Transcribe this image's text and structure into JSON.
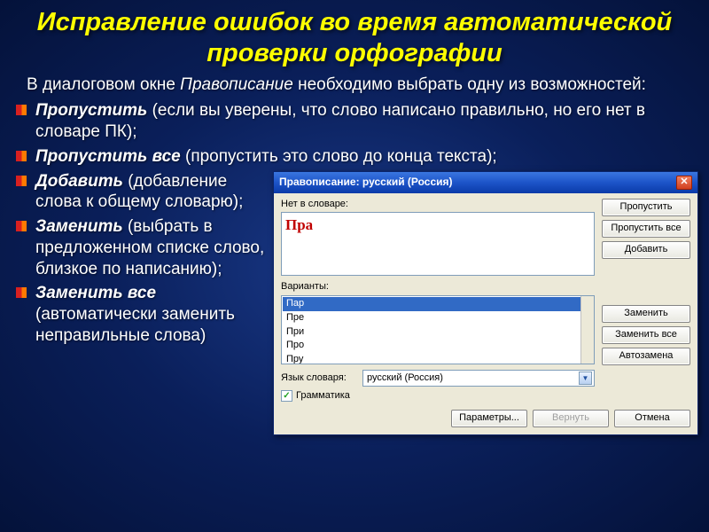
{
  "slide": {
    "title": "Исправление ошибок во время автоматической проверки орфографии",
    "intro_a": "В диалоговом окне ",
    "intro_em": "Правописание",
    "intro_b": " необходимо выбрать одну из возможностей:",
    "items": [
      {
        "term": "Пропустить",
        "rest": " (если вы уверены, что слово написано правильно, но его нет в словаре ПК);"
      },
      {
        "term": "Пропустить все ",
        "rest": " (пропустить это слово до конца текста);"
      },
      {
        "term": "Добавить ",
        "rest": " (добавление слова к общему словарю);"
      },
      {
        "term": "Заменить ",
        "rest": " (выбрать в предложенном списке слово, близкое по написанию);"
      },
      {
        "term": "Заменить все",
        "rest": " (автоматически заменить неправильные слова)"
      }
    ]
  },
  "dialog": {
    "title": "Правописание: русский (Россия)",
    "not_in_dict_label": "Нет в словаре:",
    "word": "Пра",
    "variants_label": "Варианты:",
    "variants": [
      "Пар",
      "Пре",
      "При",
      "Про",
      "Пру"
    ],
    "lang_label": "Язык словаря:",
    "lang_value": "русский (Россия)",
    "grammar_label": "Грамматика",
    "grammar_checked": "✓",
    "buttons": {
      "skip": "Пропустить",
      "skip_all": "Пропустить все",
      "add": "Добавить",
      "replace": "Заменить",
      "replace_all": "Заменить все",
      "autocorrect": "Автозамена",
      "options": "Параметры...",
      "undo": "Вернуть",
      "cancel": "Отмена"
    }
  }
}
